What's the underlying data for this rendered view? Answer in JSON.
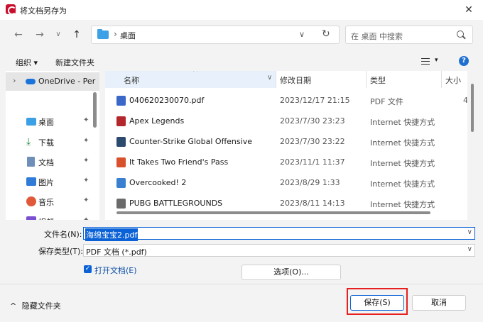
{
  "window": {
    "title": "将文档另存为",
    "close_glyph": "✕"
  },
  "nav": {
    "back": "←",
    "forward": "→",
    "dropdown": "∨",
    "up": "↑"
  },
  "address": {
    "separator": "›",
    "location": "桌面",
    "dropdown": "∨",
    "refresh": "↻"
  },
  "search": {
    "placeholder": "在 桌面 中搜索"
  },
  "toolbar": {
    "organize": "组织 ▾",
    "new_folder": "新建文件夹",
    "view_dropdown": "▾",
    "help": "?"
  },
  "sidebar": {
    "items": [
      {
        "label": "OneDrive - Per",
        "icon": "cloud-icon"
      },
      {
        "label": "桌面",
        "icon": "desktop-folder-icon",
        "pinned": true
      },
      {
        "label": "下载",
        "icon": "download-icon",
        "pinned": true
      },
      {
        "label": "文档",
        "icon": "documents-icon",
        "pinned": true
      },
      {
        "label": "图片",
        "icon": "pictures-icon",
        "pinned": true
      },
      {
        "label": "音乐",
        "icon": "music-icon",
        "pinned": true
      },
      {
        "label": "视频",
        "icon": "videos-icon",
        "pinned": true
      }
    ],
    "chevron": "›",
    "pin_glyph": "📌"
  },
  "files": {
    "columns": [
      "名称",
      "修改日期",
      "类型",
      "大小"
    ],
    "sort_glyph": "^",
    "name_dropdown": "∨",
    "rows": [
      {
        "name": "040620230070.pdf",
        "date": "2023/12/17 21:15",
        "type": "PDF 文件",
        "size": "4",
        "color": "#3a67c8"
      },
      {
        "name": "Apex Legends",
        "date": "2023/7/30 23:23",
        "type": "Internet 快捷方式",
        "size": "",
        "color": "#b3262b"
      },
      {
        "name": "Counter-Strike Global Offensive",
        "date": "2023/7/30 23:22",
        "type": "Internet 快捷方式",
        "size": "",
        "color": "#2c4a6e"
      },
      {
        "name": "It Takes Two Friend's Pass",
        "date": "2023/11/1 11:37",
        "type": "Internet 快捷方式",
        "size": "",
        "color": "#d9512c"
      },
      {
        "name": "Overcooked! 2",
        "date": "2023/8/29 1:33",
        "type": "Internet 快捷方式",
        "size": "",
        "color": "#3a7fd0"
      },
      {
        "name": "PUBG BATTLEGROUNDS",
        "date": "2023/8/11 14:13",
        "type": "Internet 快捷方式",
        "size": "",
        "color": "#6b6b6b"
      }
    ]
  },
  "form": {
    "filename_label": "文件名(N):",
    "filename_value": "海绵宝宝2.pdf",
    "filetype_label": "保存类型(T):",
    "filetype_value": "PDF 文档 (*.pdf)",
    "open_doc_label": "打开文档(E)",
    "open_doc_checked": true,
    "options_label": "选项(O)...",
    "dropdown": "∨",
    "checkmark": "✓"
  },
  "footer": {
    "hide_folders": "隐藏文件夹",
    "hide_chevron": "^",
    "save_label": "保存(S)",
    "cancel_label": "取消"
  },
  "colors": {
    "accent": "#0b62d6",
    "highlight": "#e62020",
    "bg": "#f3f3f3"
  }
}
